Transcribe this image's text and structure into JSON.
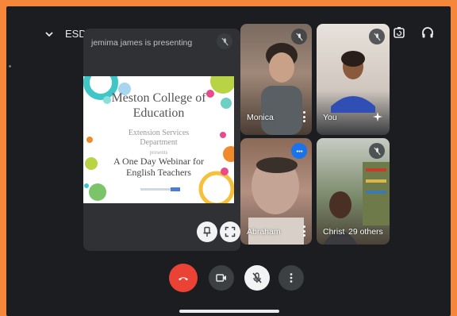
{
  "header": {
    "meeting_code": "ESD",
    "icons": [
      "chevron-down-icon",
      "switch-camera-icon",
      "headphones-icon"
    ]
  },
  "presentation": {
    "label": "jemima james is presenting",
    "slide": {
      "title_line1": "Meston College of",
      "title_line2": "Education",
      "subtitle_line1": "Extension Services",
      "subtitle_line2": "Department",
      "presents": "presents",
      "event_line1": "A One Day Webinar for",
      "event_line2": "English Teachers"
    }
  },
  "participants": [
    {
      "name": "Monica"
    },
    {
      "name": "You"
    },
    {
      "name": "Abraham"
    },
    {
      "name": "Christ",
      "extra": "29 others"
    }
  ],
  "controls": {
    "icons": [
      "end-call-icon",
      "camera-icon",
      "mic-off-icon",
      "more-icon"
    ]
  },
  "colors": {
    "frame": "#f4873a",
    "background": "#1c1d20",
    "end_call": "#ea4335",
    "tile_more_blue": "#1a73e8"
  }
}
